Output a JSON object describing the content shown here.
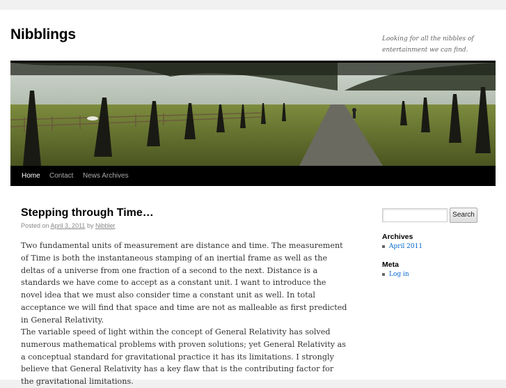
{
  "site": {
    "title": "Nibblings",
    "tagline": "Looking for all the nibbles of entertainment we can find."
  },
  "nav": {
    "items": [
      {
        "label": "Home",
        "active": true
      },
      {
        "label": "Contact",
        "active": false
      },
      {
        "label": "News Archives",
        "active": false
      }
    ]
  },
  "post": {
    "title": "Stepping through Time…",
    "meta_prefix": "Posted on",
    "date": "April 3, 2011",
    "meta_by": "by",
    "author": "Nibbler",
    "paragraphs": [
      "Two fundamental units of measurement are distance and time. The measurement of Time is both the instantaneous stamping of an inertial frame as well as the deltas of a universe from one fraction of a second to the next. Distance is a standards we have come to accept as a constant unit. I want to introduce the novel idea that we must also consider time a constant unit as well. In total acceptance we will find that space and time are not as malleable as first predicted in General Relativity.",
      "The variable speed of light within the concept of General Relativity has solved numerous mathematical problems with proven solutions; yet General Relativity as a conceptual standard for gravitational practice it has its limitations. I strongly believe that General Relativity has a key flaw that is the contributing factor for the gravitational limitations."
    ]
  },
  "sidebar": {
    "search_button": "Search",
    "archives_title": "Archives",
    "archives_items": [
      "April 2011"
    ],
    "meta_title": "Meta",
    "meta_items": [
      "Log in"
    ]
  },
  "colors": {
    "link": "#0066cc",
    "nav_bg": "#000000",
    "nav_active": "#ffffff"
  },
  "icons": {
    "banner": "tree-lined-path-image"
  }
}
